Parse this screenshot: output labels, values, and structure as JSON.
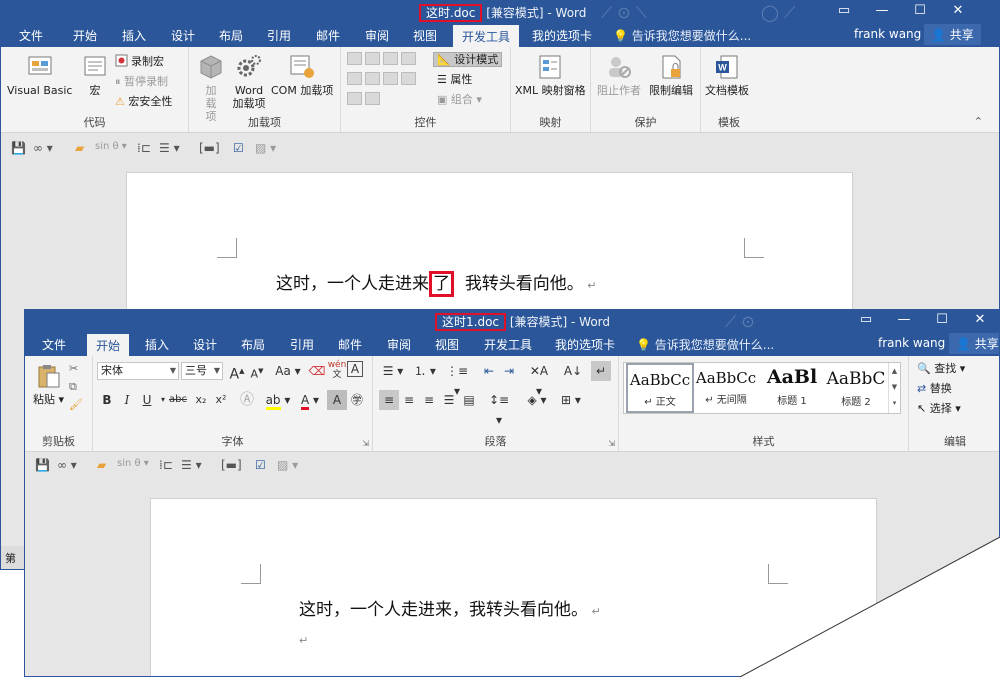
{
  "window_a": {
    "title_highlight": "这时.doc",
    "title_rest": "[兼容模式] - Word",
    "tabs": [
      "文件",
      "开始",
      "插入",
      "设计",
      "布局",
      "引用",
      "邮件",
      "审阅",
      "视图",
      "开发工具",
      "我的选项卡"
    ],
    "active_tab": "开发工具",
    "tell_me": "告诉我您想要做什么...",
    "user": "frank wang",
    "share": "共享",
    "ribbon": {
      "code": {
        "label": "代码",
        "visual_basic": "Visual Basic",
        "macros": "宏",
        "record_macro": "录制宏",
        "pause_recording": "暂停录制",
        "macro_security": "宏安全性"
      },
      "addins": {
        "label": "加载项",
        "addins": "加载项",
        "word_addins": "Word 加载项",
        "com_addins": "COM 加载项"
      },
      "controls": {
        "label": "控件",
        "design_mode": "设计模式",
        "properties": "属性",
        "group": "组合"
      },
      "mapping": {
        "label": "映射",
        "xml_pane": "XML 映射窗格"
      },
      "protect": {
        "label": "保护",
        "block_authors": "阻止作者",
        "restrict_editing": "限制编辑"
      },
      "templates": {
        "label": "模板",
        "document_template": "文档模板"
      }
    },
    "qat_items": [
      "sin θ"
    ],
    "doc": {
      "before": "这时，一个人走进来",
      "marked": "了",
      "after": "我转头看向他。"
    },
    "status": "第"
  },
  "window_b": {
    "title_highlight": "这时1.doc",
    "title_rest": "[兼容模式] - Word",
    "tabs": [
      "文件",
      "开始",
      "插入",
      "设计",
      "布局",
      "引用",
      "邮件",
      "审阅",
      "视图",
      "开发工具",
      "我的选项卡"
    ],
    "active_tab": "开始",
    "tell_me": "告诉我您想要做什么...",
    "user": "frank wang",
    "share": "共享",
    "ribbon": {
      "clipboard": {
        "label": "剪贴板",
        "paste": "粘贴"
      },
      "font": {
        "label": "字体",
        "font_name": "宋体",
        "font_size": "三号",
        "bold": "B",
        "italic": "I",
        "underline": "U",
        "strike": "abc",
        "sub": "x₂",
        "sup": "x²",
        "change_case": "Aa",
        "phonetic": "wén",
        "grow": "A",
        "shrink": "A"
      },
      "paragraph": {
        "label": "段落"
      },
      "styles": {
        "label": "样式",
        "items": [
          {
            "preview": "AaBbCc",
            "name": "↵ 正文"
          },
          {
            "preview": "AaBbCc",
            "name": "↵ 无间隔"
          },
          {
            "preview": "AaBl",
            "name": "标题 1"
          },
          {
            "preview": "AaBbC",
            "name": "标题 2"
          }
        ]
      },
      "editing": {
        "label": "编辑",
        "find": "查找",
        "replace": "替换",
        "select": "选择"
      }
    },
    "doc": {
      "text": "这时，一个人走进来，我转头看向他。"
    }
  },
  "colors": {
    "word_blue": "#2b579a",
    "highlight_red": "#e0102a",
    "ribbon_bg": "#f3f3f3"
  }
}
